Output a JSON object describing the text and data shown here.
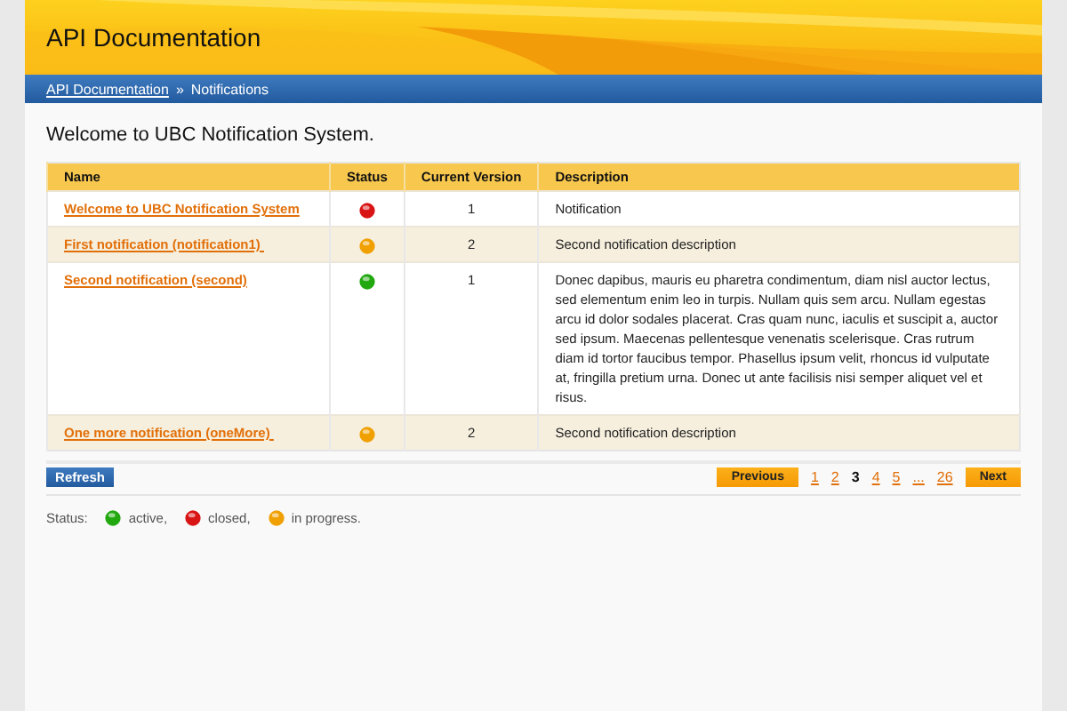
{
  "header": {
    "title": "API Documentation"
  },
  "breadcrumb": [
    {
      "label": "API Documentation",
      "link": true
    },
    {
      "label": "»",
      "link": false
    },
    {
      "label": "Notifications",
      "link": false
    }
  ],
  "page_title": "Welcome to UBC Notification System.",
  "table": {
    "columns": [
      "Name",
      "Status",
      "Current Version",
      "Description"
    ],
    "rows": [
      {
        "name": "Welcome to UBC Notification System",
        "color": "#d81414",
        "version": "1",
        "description": "Notification"
      },
      {
        "name": "First notification (notification1) ",
        "color": "#f0a000",
        "version": "2",
        "description": "Second notification description"
      },
      {
        "name": "Second notification (second)",
        "color": "#21a80f",
        "version": "1",
        "description": "Donec dapibus, mauris eu pharetra condimentum, diam nisl auctor lectus, sed elementum enim leo in turpis. Nullam quis sem arcu. Nullam egestas arcu id dolor sodales placerat. Cras quam nunc, iaculis et suscipit a, auctor sed ipsum. Maecenas pellentesque venenatis scelerisque. Cras rutrum diam id tortor faucibus tempor. Phasellus ipsum velit, rhoncus id vulputate at, fringilla pretium urna. Donec ut ante facilisis nisi semper aliquet vel et risus."
      },
      {
        "name": "One more notification (oneMore) ",
        "color": "#f0a000",
        "version": "2",
        "description": "Second notification description"
      }
    ]
  },
  "refresh_button": "Refresh",
  "pagination": {
    "previous": "Previous",
    "next": "Next",
    "pages": [
      {
        "label": "1",
        "selected": false
      },
      {
        "label": "2",
        "selected": false
      },
      {
        "label": "3",
        "selected": true
      },
      {
        "label": "4",
        "selected": false
      },
      {
        "label": "5",
        "selected": false
      },
      {
        "label": "...",
        "selected": false
      },
      {
        "label": "26",
        "selected": false
      }
    ]
  },
  "legend": {
    "label": "Status:",
    "items": [
      {
        "color": "#21a80f",
        "label": "active,"
      },
      {
        "color": "#d81414",
        "label": "closed,"
      },
      {
        "color": "#f0a000",
        "label": "in progress."
      }
    ]
  }
}
